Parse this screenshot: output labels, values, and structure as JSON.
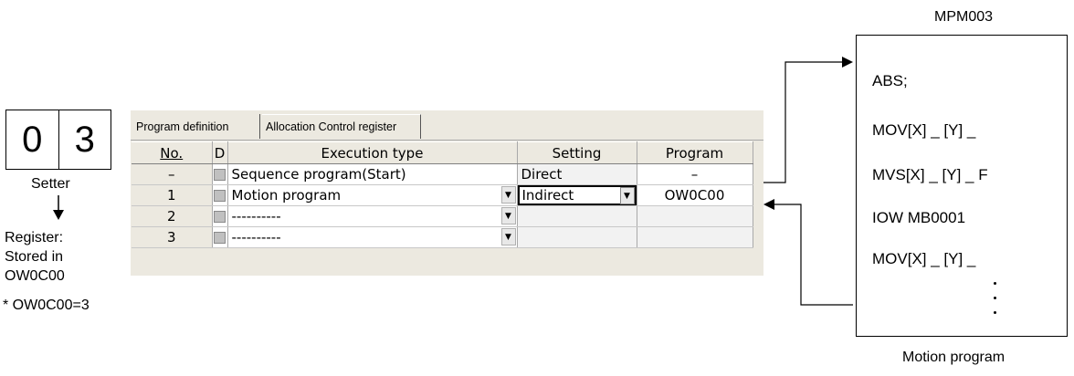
{
  "setter": {
    "digits": [
      "0",
      "3"
    ],
    "label": "Setter",
    "register_note": [
      "Register:",
      "Stored in",
      "OW0C00"
    ],
    "footnote": "* OW0C00=3"
  },
  "window": {
    "tabs": [
      "Program definition",
      "Allocation Control register"
    ],
    "columns": [
      "No.",
      "D",
      "Execution type",
      "Setting",
      "Program"
    ],
    "rows": [
      {
        "no": "–",
        "type": "Sequence program(Start)",
        "setting": "Direct",
        "program": "–"
      },
      {
        "no": "1",
        "type": "Motion program",
        "setting": "Indirect",
        "program": "OW0C00"
      },
      {
        "no": "2",
        "type": "----------",
        "setting": "",
        "program": ""
      },
      {
        "no": "3",
        "type": "----------",
        "setting": "",
        "program": ""
      }
    ]
  },
  "motion": {
    "title": "MPM003",
    "lines": [
      "ABS;",
      "MOV[X] _ [Y] _",
      "MVS[X] _ [Y] _ F",
      "IOW MB0001",
      "MOV[X] _ [Y] _"
    ],
    "caption": "Motion program"
  },
  "icons": {
    "down_arrow": "down-arrow-icon",
    "dropdown": "chevron-down-icon"
  }
}
